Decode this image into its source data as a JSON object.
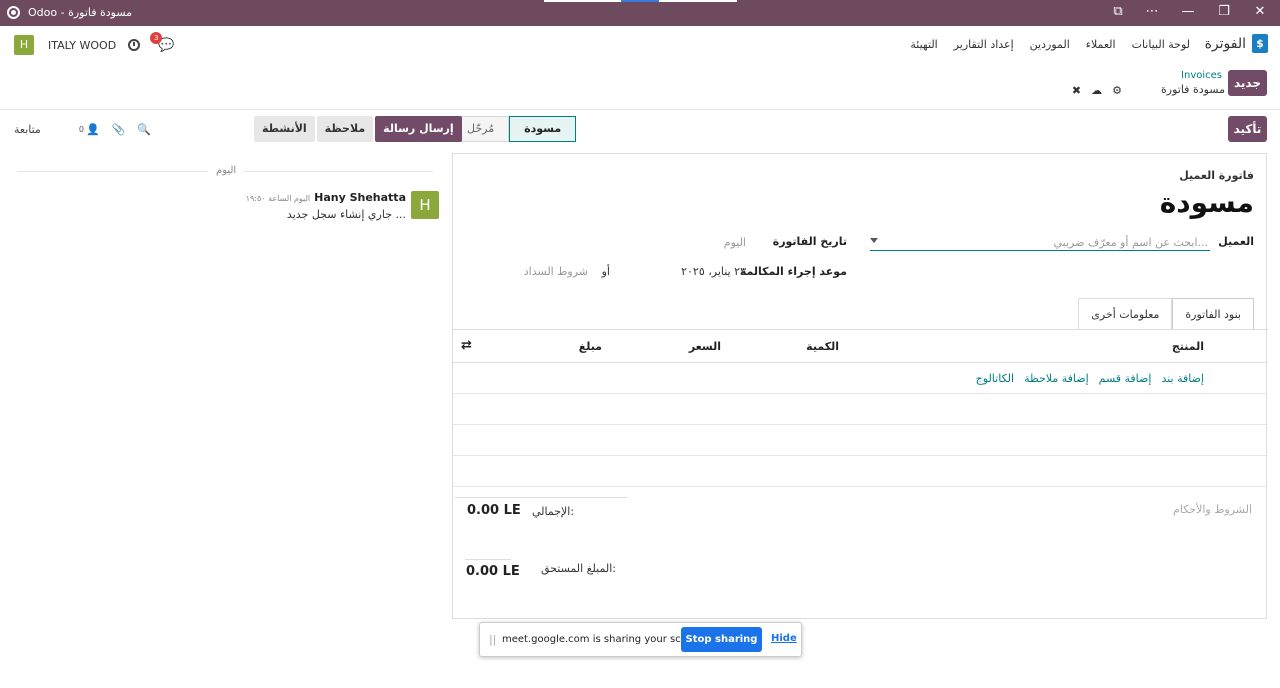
{
  "window": {
    "title": "مسودة فاتورة - Odoo"
  },
  "nav": {
    "brand": "الفوترة",
    "menu": [
      "لوحة البيانات",
      "العملاء",
      "الموردين",
      "إعداد التقارير",
      "التهيئة"
    ],
    "company": "ITALY WOOD",
    "avatar_letter": "H",
    "chat_badge": "3"
  },
  "control_panel": {
    "new_button": "جديد",
    "breadcrumb_parent": "Invoices",
    "breadcrumb_current": "مسودة فاتورة"
  },
  "actions": {
    "confirm_button": "تأكيد",
    "status_steps": [
      "مسودة",
      "مُرحّل"
    ],
    "active_status": "مسودة"
  },
  "chatter": {
    "send_message": "إرسال رسالة",
    "log_note": "ملاحظة",
    "activities": "الأنشطة",
    "follow": "متابعة",
    "followers_count": "0",
    "date_separator": "اليوم",
    "message": {
      "avatar_letter": "H",
      "author": "Hany Shehatta",
      "time": "اليوم الساعة ١٩:٥٠",
      "body": "جاري إنشاء سجل جديد ..."
    }
  },
  "form": {
    "subtitle": "فاتورة العميل",
    "title": "مسودة",
    "customer_label": "العميل",
    "customer_placeholder": "ابحث عن اسم أو معرّف ضريبي...",
    "invoice_date_label": "تاريخ الفاتورة",
    "invoice_date_placeholder": "اليوم",
    "due_date_label": "موعد إجراء المكالمة",
    "due_date_value": "٢٣ يناير، ٢٠٢٥",
    "or_text": "أو",
    "payment_terms_placeholder": "شروط السداد",
    "tabs": [
      "بنود الفاتورة",
      "معلومات أخرى"
    ],
    "active_tab": "بنود الفاتورة",
    "columns": {
      "product": "المنتج",
      "quantity": "الكمية",
      "price": "السعر",
      "amount": "مبلغ"
    },
    "add_links": [
      "إضافة بند",
      "إضافة قسم",
      "إضافة ملاحظة",
      "الكاتالوج"
    ],
    "terms_placeholder": "الشروط والأحكام",
    "total_label": "الإجمالي:",
    "total_value": "0.00 LE",
    "amount_due_label": "المبلغ المستحق:",
    "amount_due_value": "0.00 LE"
  },
  "share_banner": {
    "message": "meet.google.com is sharing your screen.",
    "stop_button": "Stop sharing",
    "hide_link": "Hide"
  }
}
